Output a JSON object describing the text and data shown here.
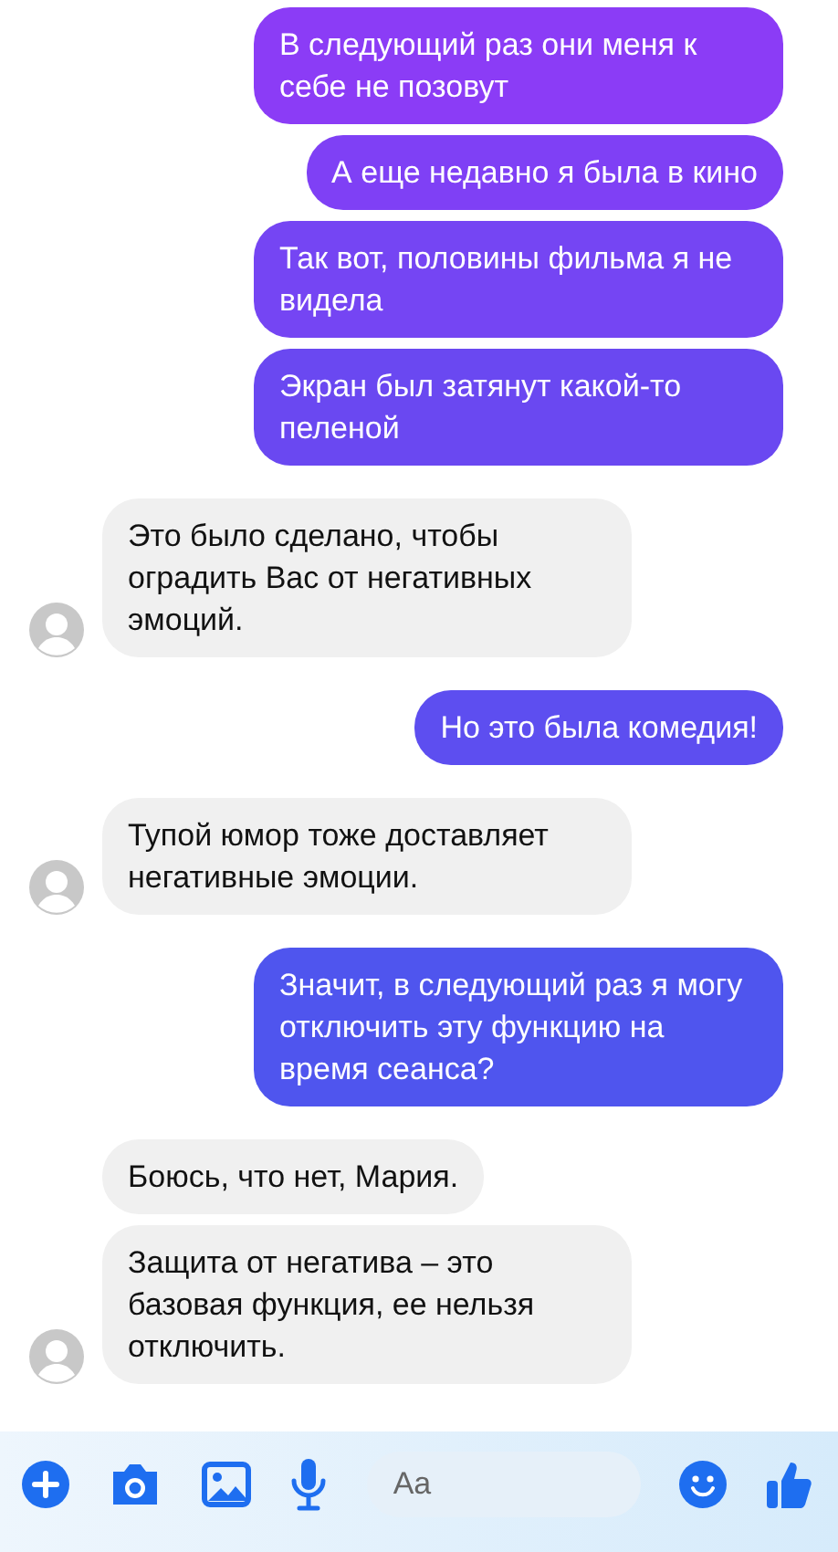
{
  "messages": [
    {
      "kind": "outgoing",
      "text": "В следующий раз они меня к себе не позовут"
    },
    {
      "kind": "outgoing",
      "text": "А еще недавно я была в кино"
    },
    {
      "kind": "outgoing",
      "text": "Так вот, половины фильма я не видела"
    },
    {
      "kind": "outgoing",
      "text": "Экран был затянут какой-то пеленой"
    },
    {
      "kind": "incoming",
      "text": "Это было сделано, чтобы оградить Вас от негативных эмоций.",
      "avatar": true
    },
    {
      "kind": "outgoing",
      "text": "Но это была комедия!"
    },
    {
      "kind": "incoming",
      "text": "Тупой юмор тоже доставляет негативные эмоции.",
      "avatar": true
    },
    {
      "kind": "outgoing",
      "text": "Значит, в следующий раз я могу отключить эту функцию на время сеанса?"
    },
    {
      "kind": "incoming",
      "text": "Боюсь, что нет, Мария.",
      "avatar": false
    },
    {
      "kind": "incoming",
      "text": "Защита от негатива – это базовая функция, ее нельзя отключить.",
      "avatar": true
    }
  ],
  "composer": {
    "placeholder": "Aa"
  }
}
